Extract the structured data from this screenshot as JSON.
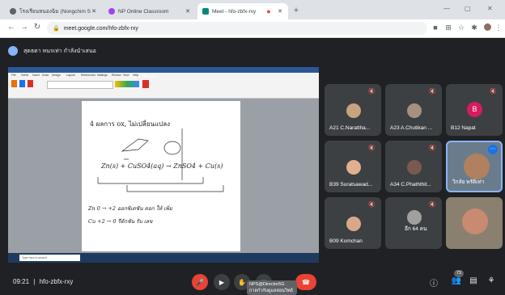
{
  "browser": {
    "tabs": [
      {
        "label": "โรงเรียนหนองฉิม (Nongchim School)",
        "fav_color": "#5f6368"
      },
      {
        "label": "NP Online Classroom",
        "fav_color": "#a142f4"
      },
      {
        "label": "Meet - hfo-zbfx-rxy",
        "fav_color": "#00897b"
      }
    ],
    "url": "meet.google.com/hfo-zbfx-rxy",
    "window": {
      "minimize": "—",
      "maximize": "▢",
      "close": "✕"
    }
  },
  "meet": {
    "presenter_text": "สุดธดา หนรเท่า กำลังนำเสนอ",
    "presentation": {
      "window_title": "Document1 - Word",
      "ribbon_tabs": [
        "File",
        "Home",
        "Insert",
        "Draw",
        "Design",
        "Layout",
        "References",
        "Mailings",
        "Review",
        "View",
        "Help"
      ],
      "handwriting": {
        "heading": "4   ผลการ ox, ไม่เปลี่ยนแปลง",
        "line1": "Zn(s) + CuSO4(aq) → ZnSO4 + Cu(s)",
        "line2": "Zn  0 → +2  ออกซิเดชัน ตอก ให้ เพิ่ม",
        "line3": "Cu  +2 → 0  รีดักชัน รับ เลข"
      },
      "taskbar_search": "Type here to search"
    },
    "participants": [
      {
        "name": "A21 C.Narattha...",
        "avatar": "photo"
      },
      {
        "name": "A23 A.Chutikan ...",
        "avatar": "photo"
      },
      {
        "name": "B12 Napat",
        "avatar": "B"
      },
      {
        "name": "B39 Suratsawad...",
        "avatar": "photo"
      },
      {
        "name": "A34 C.Phaththit...",
        "avatar": "photo"
      },
      {
        "name": "วิกลัย พรัติเท่า",
        "avatar": "photo"
      },
      {
        "name": "B09 Komchan",
        "avatar": "photo"
      },
      {
        "name": "อีก 64 คน",
        "avatar": "group"
      },
      {
        "name": "",
        "avatar": "photo"
      }
    ],
    "bottom": {
      "time": "09:21",
      "separator": "|",
      "meeting_code": "hfo-zbfx-rxy",
      "tooltip_line1": "NPS@Director5G",
      "tooltip_line2": "กาลกำกับดูแลสอนวิทย์",
      "participant_count": "73"
    },
    "colors": {
      "end_call": "#ea4335",
      "mic_off": "#ea4335",
      "background": "#202124",
      "tile": "#3c4043"
    }
  }
}
